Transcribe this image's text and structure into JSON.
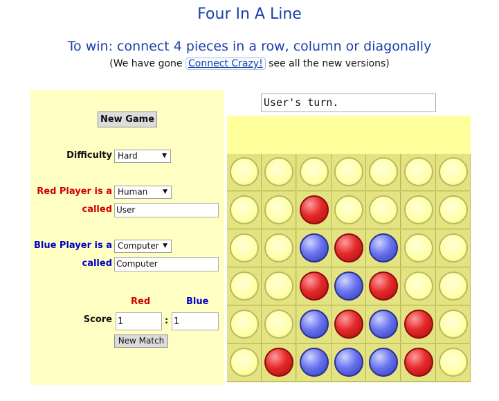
{
  "title": "Four In A Line",
  "subtitle": "To win: connect 4 pieces in a row, column or diagonally",
  "note": {
    "prefix": "(We have gone",
    "link": "Connect Crazy!",
    "suffix": "see all the new versions)"
  },
  "panel": {
    "new_game": "New Game",
    "difficulty_label": "Difficulty",
    "difficulty_value": "Hard",
    "red_player_label": "Red Player is a",
    "red_player_type": "Human",
    "red_called_label": "called",
    "red_name": "User",
    "blue_player_label": "Blue Player is a",
    "blue_player_type": "Computer",
    "blue_called_label": "called",
    "blue_name": "Computer",
    "score_red_header": "Red",
    "score_blue_header": "Blue",
    "score_label": "Score",
    "red_score": "1",
    "score_separator": ":",
    "blue_score": "1",
    "new_match": "New Match"
  },
  "status": "User's turn.",
  "colors": {
    "red": "#e42a2a",
    "blue": "#3d49d8",
    "panel_bg": "#ffffc4",
    "board_bg": "#e3e382"
  },
  "board": [
    [
      "empty",
      "empty",
      "empty",
      "empty",
      "empty",
      "empty",
      "empty"
    ],
    [
      "empty",
      "empty",
      "red",
      "empty",
      "empty",
      "empty",
      "empty"
    ],
    [
      "empty",
      "empty",
      "blue",
      "red",
      "blue",
      "empty",
      "empty"
    ],
    [
      "empty",
      "empty",
      "red",
      "blue",
      "red",
      "empty",
      "empty"
    ],
    [
      "empty",
      "empty",
      "blue",
      "red",
      "blue",
      "red",
      "empty"
    ],
    [
      "empty",
      "red",
      "blue",
      "blue",
      "blue",
      "red",
      "empty"
    ]
  ]
}
